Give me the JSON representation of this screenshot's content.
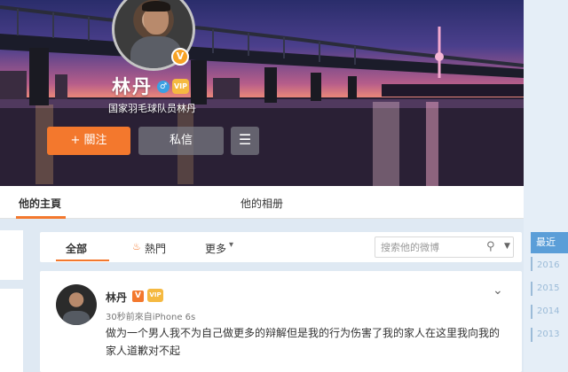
{
  "profile": {
    "name": "林丹",
    "bio": "国家羽毛球队员林丹",
    "badge": "V",
    "gender_icon": "male-icon",
    "vip_label": "VIP"
  },
  "actions": {
    "follow": "+ 關注",
    "message": "私信",
    "more_icon": "menu-icon"
  },
  "tabs": {
    "home": "他的主頁",
    "album": "他的相册"
  },
  "feed_filter": {
    "all": "全部",
    "hot": "熱門",
    "more": "更多",
    "search_placeholder": "搜索他的微博"
  },
  "post": {
    "author": "林丹",
    "meta": "30秒前來自iPhone 6s",
    "text": "做为一个男人我不为自己做更多的辩解但是我的行为伤害了我的家人在这里我向我的家人道歉对不起"
  },
  "timeline": {
    "header": "最近",
    "years": [
      "2016",
      "2015",
      "2014",
      "2013"
    ]
  },
  "colors": {
    "accent": "#f3782d",
    "timeline": "#5b9ed8"
  }
}
